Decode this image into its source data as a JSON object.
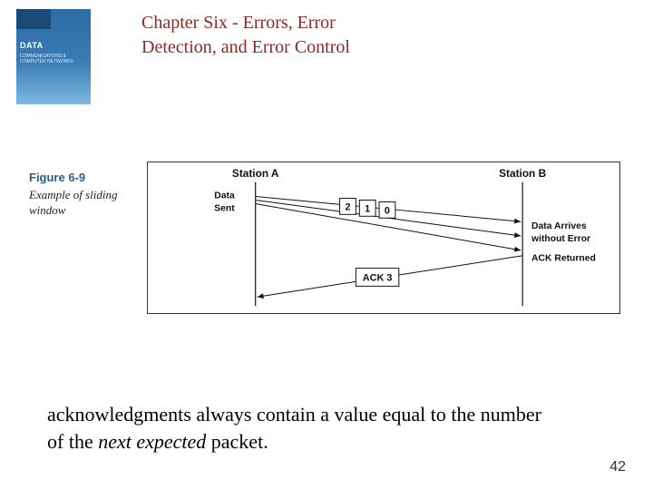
{
  "book": {
    "title_line1": "DATA",
    "subtitle": "COMMUNICATIONS & COMPUTER NETWORKS"
  },
  "chapter_title": "Chapter Six - Errors, Error Detection, and Error Control",
  "figure": {
    "label": "Figure 6-9",
    "caption": "Example of sliding window"
  },
  "diagram": {
    "station_a": "Station A",
    "station_b": "Station B",
    "data_sent": "Data\nSent",
    "packets": [
      "2",
      "1",
      "0"
    ],
    "ack_label": "ACK 3",
    "arrives_line1": "Data Arrives",
    "arrives_line2": "without Error",
    "ack_returned": "ACK Returned"
  },
  "footer_text_pre": "acknowledgments always contain a value equal to the number of the ",
  "footer_text_italic": "next expected",
  "footer_text_post": " packet.",
  "page_number": "42"
}
